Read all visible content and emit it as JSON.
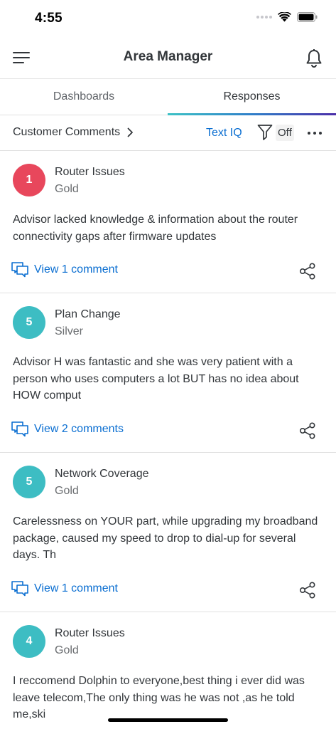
{
  "status_bar": {
    "time": "4:55"
  },
  "header": {
    "title": "Area Manager"
  },
  "tabs": [
    {
      "label": "Dashboards",
      "active": false
    },
    {
      "label": "Responses",
      "active": true
    }
  ],
  "filter_bar": {
    "breadcrumb": "Customer Comments",
    "text_iq_label": "Text IQ",
    "filter_state": "Off"
  },
  "cards": [
    {
      "score": "1",
      "score_color": "#e8475c",
      "title": "Router Issues",
      "tier": "Gold",
      "body": "Advisor lacked knowledge & information about the router connectivity gaps after firmware updates",
      "comment_link": "View 1 comment"
    },
    {
      "score": "5",
      "score_color": "#3dbdc3",
      "title": "Plan Change",
      "tier": "Silver",
      "body": "Advisor H was fantastic and she was very patient with a person who uses computers a lot BUT has no idea about HOW comput",
      "comment_link": "View 2 comments"
    },
    {
      "score": "5",
      "score_color": "#3dbdc3",
      "title": "Network Coverage",
      "tier": "Gold",
      "body": "Carelessness on YOUR part, while upgrading my broadband package, caused my speed to drop to dial-up for several days. Th",
      "comment_link": "View 1 comment"
    },
    {
      "score": "4",
      "score_color": "#3dbdc3",
      "title": "Router Issues",
      "tier": "Gold",
      "body": "I reccomend Dolphin to everyone,best thing i ever did was leave telecom,The only thing was he was not ,as he told me,ski"
    }
  ],
  "colors": {
    "accent_link": "#0a6ed1",
    "text_primary": "#32363a",
    "text_secondary": "#6a6d70"
  },
  "icons": [
    "hamburger-menu-icon",
    "bell-icon",
    "chevron-right-icon",
    "filter-funnel-icon",
    "more-horizontal-icon",
    "comments-icon",
    "share-icon"
  ]
}
